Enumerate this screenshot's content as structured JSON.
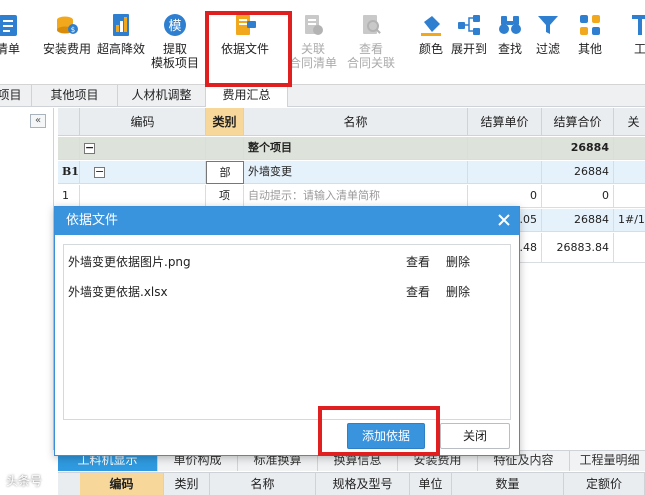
{
  "toolbar": {
    "items": [
      {
        "l1": "清单",
        "l2": "",
        "icon": "list-icon",
        "dim": false
      },
      {
        "l1": "安装费用",
        "l2": "",
        "icon": "coins-icon",
        "dim": false
      },
      {
        "l1": "超高降效",
        "l2": "",
        "icon": "document-chart-icon",
        "dim": false
      },
      {
        "l1": "提取",
        "l2": "模板项目",
        "icon": "template-icon",
        "dim": false
      },
      {
        "l1": "依据文件",
        "l2": "",
        "icon": "basis-file-icon",
        "dim": false
      },
      {
        "l1": "关联",
        "l2": "合同清单",
        "icon": "link-contract-icon",
        "dim": true
      },
      {
        "l1": "查看",
        "l2": "合同关联",
        "icon": "view-contract-icon",
        "dim": true
      },
      {
        "l1": "颜色",
        "l2": "",
        "icon": "paint-bucket-icon",
        "dim": false
      },
      {
        "l1": "展开到",
        "l2": "",
        "icon": "tree-expand-icon",
        "dim": false
      },
      {
        "l1": "查找",
        "l2": "",
        "icon": "binoculars-icon",
        "dim": false
      },
      {
        "l1": "过滤",
        "l2": "",
        "icon": "filter-icon",
        "dim": false
      },
      {
        "l1": "其他",
        "l2": "",
        "icon": "grid-apps-icon",
        "dim": false
      },
      {
        "l1": "工",
        "l2": "",
        "icon": "tools-icon",
        "dim": false
      }
    ]
  },
  "tabs": [
    "项目",
    "其他项目",
    "人材机调整",
    "费用汇总"
  ],
  "grid": {
    "headers": [
      "编码",
      "类别",
      "名称",
      "结算单价",
      "结算合价",
      "关"
    ],
    "rows": [
      {
        "rownum": "",
        "code": "−",
        "type": "",
        "name": "整个项目",
        "price": "",
        "total": "26884",
        "link": ""
      },
      {
        "rownum": "B1",
        "code": "−",
        "type": "部",
        "name": "外墙变更",
        "price": "",
        "total": "26884",
        "link": ""
      },
      {
        "rownum": "1",
        "code": "",
        "type": "项",
        "name": "自动提示：请输入清单简称",
        "price": "0",
        "total": "0",
        "link": ""
      },
      {
        "rownum": "",
        "code": "",
        "type": "",
        "name": "",
        "price": ".05",
        "total": "26884",
        "link": "1#/1#"
      },
      {
        "rownum": "",
        "code": "",
        "type": "",
        "name": "",
        "price": ".48",
        "total": "26883.84",
        "link": ""
      }
    ]
  },
  "bottom_tabs": [
    "工料机显示",
    "单价构成",
    "标准换算",
    "换算信息",
    "安装费用",
    "特征及内容",
    "工程量明细"
  ],
  "bottom_headers": [
    "编码",
    "类别",
    "名称",
    "规格及型号",
    "单位",
    "数量",
    "定额价"
  ],
  "dialog": {
    "title": "依据文件",
    "files": [
      {
        "name": "外墙变更依据图片.png",
        "view": "查看",
        "delete": "删除"
      },
      {
        "name": "外墙变更依据.xlsx",
        "view": "查看",
        "delete": "删除"
      }
    ],
    "add_button": "添加依据",
    "close_button": "关闭"
  },
  "watermark": "头条号",
  "colors": {
    "accent": "#3a93dd",
    "annotation": "#e02020",
    "selected_header": "#f7d79a"
  }
}
